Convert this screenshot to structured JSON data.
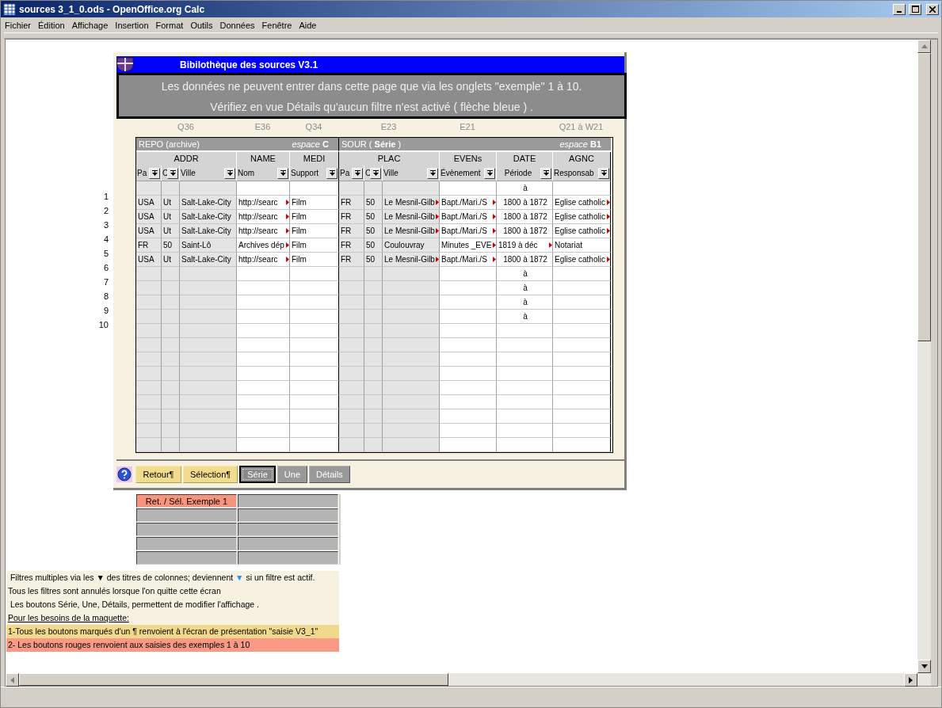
{
  "window": {
    "title": "sources 3_1_0.ods - OpenOffice.org Calc"
  },
  "menu": [
    "Fichier",
    "Édition",
    "Affichage",
    "Insertion",
    "Format",
    "Outils",
    "Données",
    "Fenêtre",
    "Aide"
  ],
  "panel": {
    "title": "Bibilothèque des sources  V3.1",
    "messages": [
      "Les données ne peuvent entrer dans cette page que via les onglets \"exemple\" 1 à 10.",
      "Vérifiez en vue Détails qu'aucun filtre n'est activé ( flèche bleue ) ."
    ],
    "sections": [
      {
        "label": "REPO (archive)",
        "space": "*espace* **C**",
        "groups": [
          {
            "label": "ADDR",
            "hint": "Q36",
            "columns": [
              "Pa",
              "C",
              "Ville"
            ]
          },
          {
            "label": "NAME",
            "hint": "E36",
            "columns": [
              "Nom"
            ]
          },
          {
            "label": "MEDI",
            "hint": "Q34",
            "columns": [
              "Support"
            ]
          }
        ]
      },
      {
        "label": "SOUR ( **Série** )",
        "space": "*espace* **B1**",
        "groups": [
          {
            "label": "PLAC",
            "hint": "E23",
            "columns": [
              "Pa",
              "C",
              "Ville"
            ]
          },
          {
            "label": "EVENs",
            "hint": "E21",
            "columns": [
              "Évènement"
            ]
          },
          {
            "label": "DATE",
            "columns": [
              "Période"
            ]
          },
          {
            "label": "AGNC",
            "hint": "Q21 à W21",
            "columns": [
              "Responsab"
            ]
          }
        ]
      }
    ],
    "rows": [
      {
        "number": "1",
        "cells": [
          null,
          null,
          null,
          null,
          null,
          null,
          null,
          null,
          null,
          {
            "text": "à",
            "clipped": false
          },
          null
        ]
      },
      {
        "number": "2",
        "cells": [
          {
            "text": "USA",
            "clipped": false
          },
          {
            "text": "Ut",
            "clipped": false
          },
          {
            "text": "Salt-Lake-City",
            "clipped": false
          },
          {
            "text": "http://searc",
            "clipped": true
          },
          {
            "text": "Film",
            "clipped": false
          },
          {
            "text": "FR",
            "clipped": false
          },
          {
            "text": "50",
            "clipped": false
          },
          {
            "text": "Le Mesnil-Gilb",
            "clipped": true
          },
          {
            "text": "Bapt./Mari./S",
            "clipped": true
          },
          {
            "text": "1800 à 1872",
            "clipped": false
          },
          {
            "text": "Eglise catholic",
            "clipped": true
          }
        ]
      },
      {
        "number": "3",
        "cells": [
          {
            "text": "USA",
            "clipped": false
          },
          {
            "text": "Ut",
            "clipped": false
          },
          {
            "text": "Salt-Lake-City",
            "clipped": false
          },
          {
            "text": "http://searc",
            "clipped": true
          },
          {
            "text": "Film",
            "clipped": false
          },
          {
            "text": "FR",
            "clipped": false
          },
          {
            "text": "50",
            "clipped": false
          },
          {
            "text": "Le Mesnil-Gilb",
            "clipped": true
          },
          {
            "text": "Bapt./Mari./S",
            "clipped": true
          },
          {
            "text": "1800 à 1872",
            "clipped": false
          },
          {
            "text": "Eglise catholic",
            "clipped": true
          }
        ]
      },
      {
        "number": "4",
        "cells": [
          {
            "text": "USA",
            "clipped": false
          },
          {
            "text": "Ut",
            "clipped": false
          },
          {
            "text": "Salt-Lake-City",
            "clipped": false
          },
          {
            "text": "http://searc",
            "clipped": true
          },
          {
            "text": "Film",
            "clipped": false
          },
          {
            "text": "FR",
            "clipped": false
          },
          {
            "text": "50",
            "clipped": false
          },
          {
            "text": "Le Mesnil-Gilb",
            "clipped": true
          },
          {
            "text": "Bapt./Mari./S",
            "clipped": true
          },
          {
            "text": "1800 à 1872",
            "clipped": false
          },
          {
            "text": "Eglise catholic",
            "clipped": true
          }
        ]
      },
      {
        "number": "5",
        "cells": [
          {
            "text": "FR",
            "clipped": false
          },
          {
            "text": "50",
            "clipped": false
          },
          {
            "text": "Saint-Lô",
            "clipped": false
          },
          {
            "text": "Archives dép",
            "clipped": true
          },
          {
            "text": "Film",
            "clipped": false
          },
          {
            "text": "FR",
            "clipped": false
          },
          {
            "text": "50",
            "clipped": false
          },
          {
            "text": "Coulouvray",
            "clipped": false
          },
          {
            "text": "Minutes _EVE",
            "clipped": true
          },
          {
            "text": "1819 à déc",
            "clipped": true
          },
          {
            "text": "Notariat",
            "clipped": false
          }
        ]
      },
      {
        "number": "6",
        "cells": [
          {
            "text": "USA",
            "clipped": false
          },
          {
            "text": "Ut",
            "clipped": false
          },
          {
            "text": "Salt-Lake-City",
            "clipped": false
          },
          {
            "text": "http://searc",
            "clipped": true
          },
          {
            "text": "Film",
            "clipped": false
          },
          {
            "text": "FR",
            "clipped": false
          },
          {
            "text": "50",
            "clipped": false
          },
          {
            "text": "Le Mesnil-Gilb",
            "clipped": true
          },
          {
            "text": "Bapt./Mari./S",
            "clipped": true
          },
          {
            "text": "1800 à 1872",
            "clipped": false
          },
          {
            "text": "Eglise catholic",
            "clipped": true
          }
        ]
      },
      {
        "number": "7",
        "cells": [
          null,
          null,
          null,
          null,
          null,
          null,
          null,
          null,
          null,
          {
            "text": "à",
            "clipped": false
          },
          null
        ]
      },
      {
        "number": "8",
        "cells": [
          null,
          null,
          null,
          null,
          null,
          null,
          null,
          null,
          null,
          {
            "text": "à",
            "clipped": false
          },
          null
        ]
      },
      {
        "number": "9",
        "cells": [
          null,
          null,
          null,
          null,
          null,
          null,
          null,
          null,
          null,
          {
            "text": "à",
            "clipped": false
          },
          null
        ]
      },
      {
        "number": "10",
        "cells": [
          null,
          null,
          null,
          null,
          null,
          null,
          null,
          null,
          null,
          {
            "text": "à",
            "clipped": false
          },
          null
        ]
      }
    ],
    "buttons": [
      {
        "label": "Retour¶",
        "kind": "nav",
        "selected": false
      },
      {
        "label": "Sélection¶",
        "kind": "nav",
        "selected": false
      },
      {
        "label": "Série",
        "kind": "view",
        "selected": true
      },
      {
        "label": "Une",
        "kind": "view",
        "selected": false
      },
      {
        "label": "Détails",
        "kind": "view",
        "selected": false
      }
    ]
  },
  "example_buttons": [
    {
      "label": "Ret. / Sél. Exemple 1",
      "color": "#f8947c"
    },
    {
      "color": "#b4b4b4"
    },
    {
      "color": "#b4b4b4"
    },
    {
      "color": "#b4b4b4"
    },
    {
      "color": "#b4b4b4"
    },
    {
      "color": "#b4b4b4"
    },
    {
      "color": "#b4b4b4"
    },
    {
      "color": "#b4b4b4"
    },
    {
      "color": "#b4b4b4"
    },
    {
      "color": "#b4b4b4"
    }
  ],
  "notes": [
    {
      "kind": "plain",
      "parts": [
        {
          "text": " Filtres multiples via les "
        },
        {
          "text": "▼",
          "color": "#000000"
        },
        {
          "text": " des titres de colonnes; deviennent "
        },
        {
          "text": "▼",
          "color": "#1e90ff"
        },
        {
          "text": " si un filtre est actif."
        }
      ]
    },
    {
      "kind": "plain",
      "parts": [
        {
          "text": "Tous les filtres sont annulés lorsque l'on quitte cette écran"
        }
      ]
    },
    {
      "kind": "plain",
      "parts": [
        {
          "text": " Les boutons Série, Une, Détails, permettent de modifier l'affichage ."
        }
      ]
    },
    {
      "kind": "heading",
      "parts": [
        {
          "text": "Pour les besoins de la maquette:"
        }
      ]
    },
    {
      "kind": "yellow",
      "parts": [
        {
          "text": "1-Tous les boutons marqués d'un ¶ renvoient à l'écran de présentation \"saisie V3_1\""
        }
      ]
    },
    {
      "kind": "red",
      "parts": [
        {
          "text": "2- Les boutons rouges renvoient aux saisies des exemples 1 à 10"
        }
      ]
    }
  ]
}
